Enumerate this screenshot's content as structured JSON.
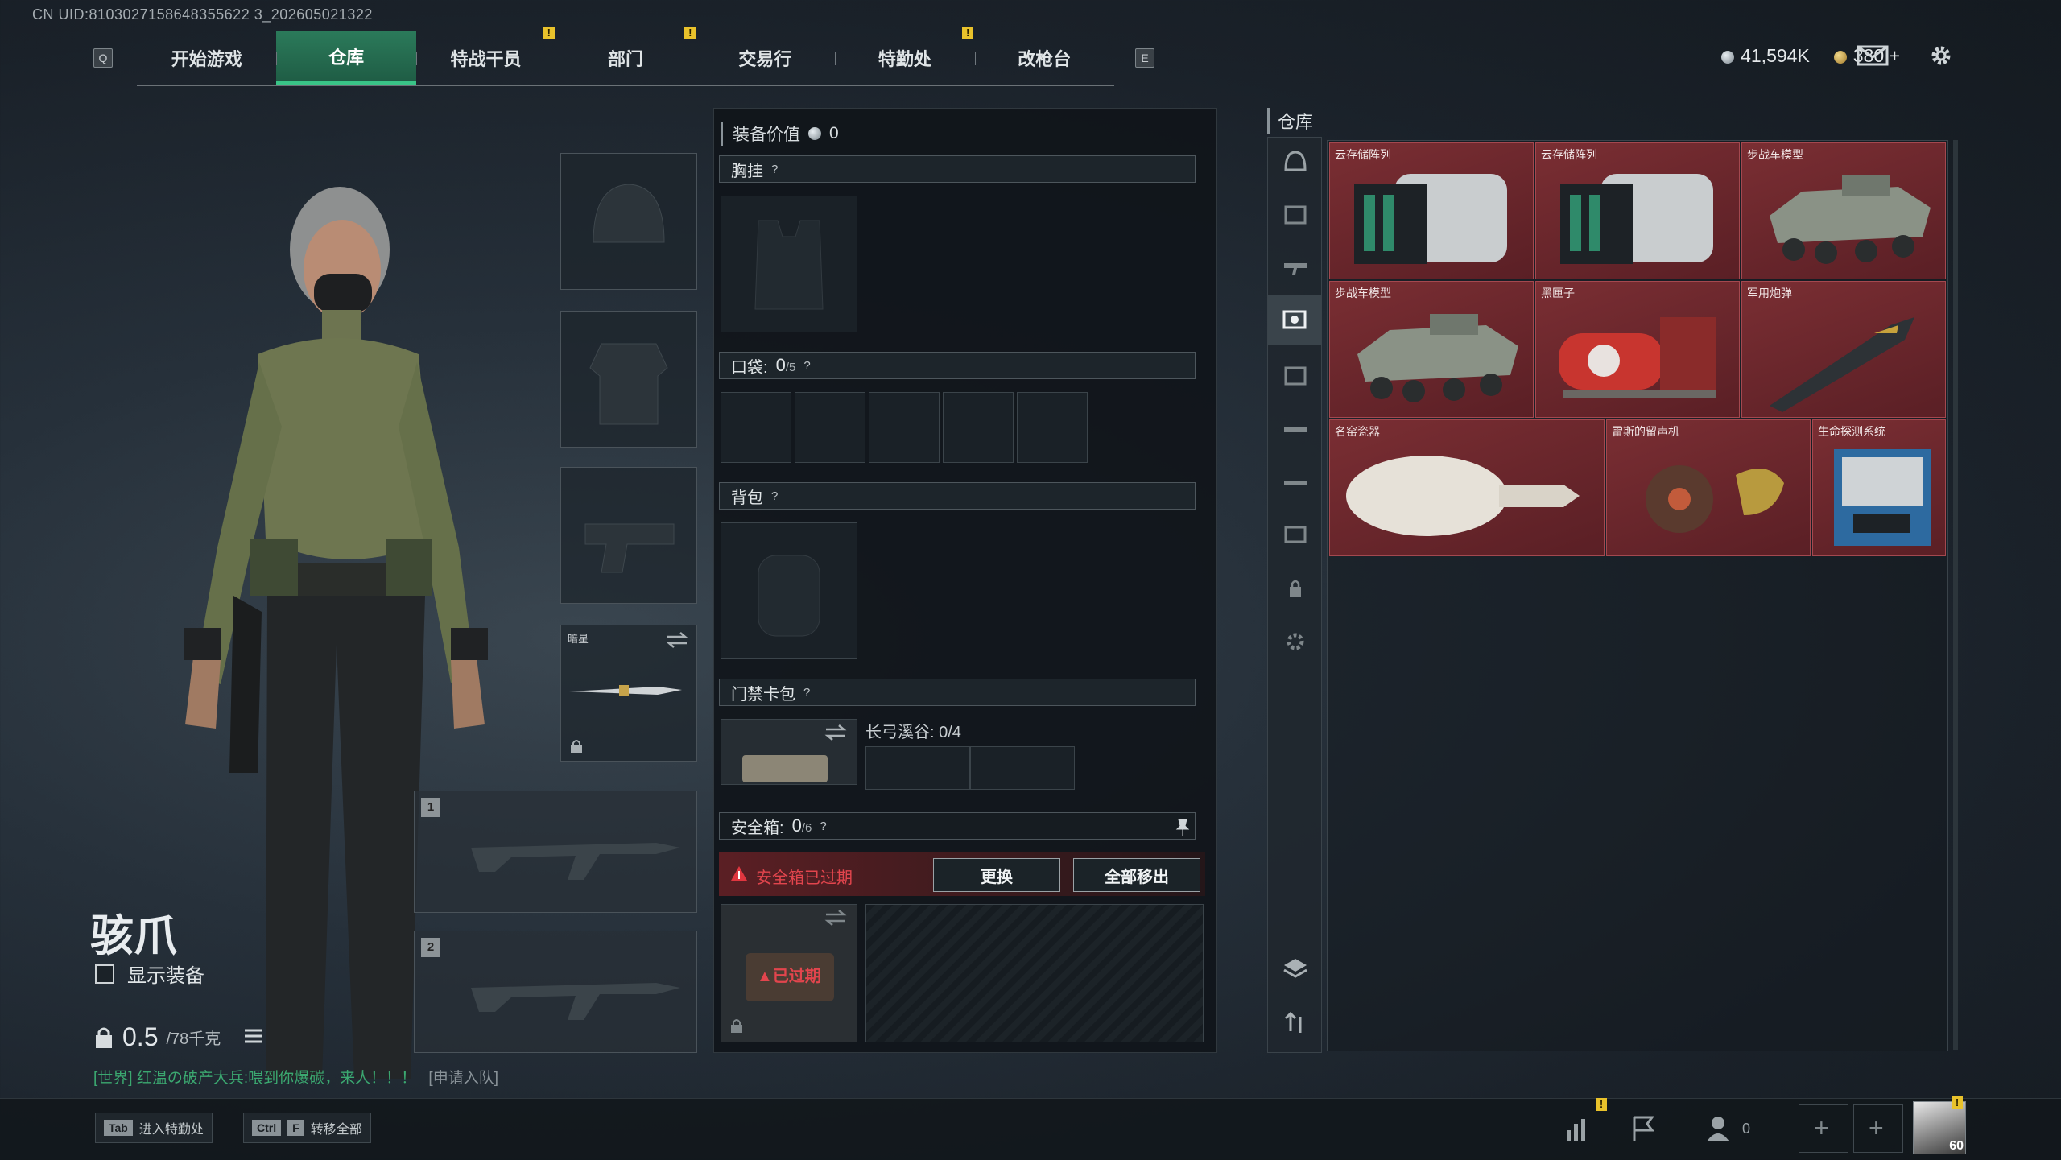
{
  "uid": "CN UID:8103027158648355622 3_202605021322",
  "nav": {
    "left_key": "Q",
    "right_key": "E",
    "tabs": [
      {
        "label": "开始游戏",
        "active": false,
        "alert": false
      },
      {
        "label": "仓库",
        "active": true,
        "alert": false
      },
      {
        "label": "特战干员",
        "active": false,
        "alert": true
      },
      {
        "label": "部门",
        "active": false,
        "alert": true
      },
      {
        "label": "交易行",
        "active": false,
        "alert": false
      },
      {
        "label": "特勤处",
        "active": false,
        "alert": true
      },
      {
        "label": "改枪台",
        "active": false,
        "alert": false
      }
    ]
  },
  "currency": {
    "silver": "41,594K",
    "gold": "380",
    "plus": "+"
  },
  "character": {
    "name": "骇爪",
    "show_equipment_label": "显示装备",
    "weight": "0.5",
    "weight_max": "/78千克"
  },
  "chat": {
    "channel": "[世界]",
    "sender": "红温の破产大兵",
    "message": ":喂到你爆碳，来人！！！",
    "link": "[申请入队]"
  },
  "slots": {
    "melee_name": "暗星",
    "weapon1_num": "1",
    "weapon2_num": "2"
  },
  "equipment": {
    "value_label": "装备价值",
    "value": "0",
    "chest_label": "胸挂",
    "pockets_label": "口袋:",
    "pockets_count": "0",
    "pockets_max": "/5",
    "backpack_label": "背包",
    "keycard_label": "门禁卡包",
    "keycard_map": "长弓溪谷: 0/4",
    "safebox_label": "安全箱:",
    "safebox_count": "0",
    "safebox_max": "/6",
    "expired_banner": "安全箱已过期",
    "replace_btn": "更换",
    "remove_all_btn": "全部移出",
    "expired_tag": "已过期",
    "question": "?"
  },
  "inventory": {
    "title": "仓库",
    "items": [
      {
        "name": "云存储阵列",
        "icon": "server-array"
      },
      {
        "name": "云存储阵列",
        "icon": "server-array"
      },
      {
        "name": "步战车模型",
        "icon": "ifv-model"
      },
      {
        "name": "步战车模型",
        "icon": "ifv-model"
      },
      {
        "name": "黑匣子",
        "icon": "black-box"
      },
      {
        "name": "军用炮弹",
        "icon": "military-shell"
      },
      {
        "name": "名窑瓷器",
        "icon": "porcelain-vase"
      },
      {
        "name": "雷斯的留声机",
        "icon": "gramophone"
      },
      {
        "name": "生命探测系统",
        "icon": "life-detector"
      }
    ]
  },
  "bottom": {
    "hint1_key": "Tab",
    "hint1_label": "进入特勤处",
    "hint2_key1": "Ctrl",
    "hint2_key2": "F",
    "hint2_label": "转移全部",
    "friends_count": "0",
    "avatar_level": "60"
  },
  "colors": {
    "accent": "#2b7a5a",
    "warning": "#e9c22b",
    "rare_item": "#7a2e33",
    "expired": "#e0363f"
  }
}
